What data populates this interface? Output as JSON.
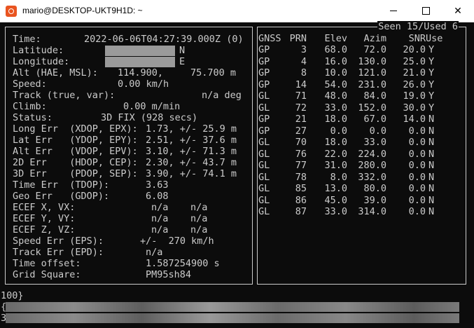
{
  "window": {
    "title": "mario@DESKTOP-UKT9H1D: ~"
  },
  "left": {
    "time": {
      "label": "Time:",
      "value": "2022-06-06T04:27:39.000Z (0)"
    },
    "latitude": {
      "label": "Latitude:",
      "hemisphere": "N"
    },
    "longitude": {
      "label": "Longitude:",
      "hemisphere": "E"
    },
    "alt": {
      "label": "Alt (HAE, MSL):",
      "value1": "114.900,",
      "value2": "75.700 m"
    },
    "speed": {
      "label": "Speed:",
      "value": "0.00 km/h"
    },
    "track": {
      "label": "Track (true, var):",
      "value": "n/a deg"
    },
    "climb": {
      "label": "Climb:",
      "value": "0.00 m/min"
    },
    "status": {
      "label": "Status:",
      "value": "3D FIX (928 secs)"
    },
    "long_err": {
      "label": "Long Err  (XDOP, EPX):",
      "value": "1.73, +/- 25.9 m"
    },
    "lat_err": {
      "label": "Lat Err   (YDOP, EPY):",
      "value": "2.51, +/- 37.6 m"
    },
    "alt_err": {
      "label": "Alt Err   (VDOP, EPV):",
      "value": "3.10, +/- 71.3 m"
    },
    "err_2d": {
      "label": "2D Err    (HDOP, CEP):",
      "value": "2.30, +/- 43.7 m"
    },
    "err_3d": {
      "label": "3D Err    (PDOP, SEP):",
      "value": "3.90, +/- 74.1 m"
    },
    "time_err": {
      "label": "Time Err  (TDOP):",
      "value": "3.63"
    },
    "geo_err": {
      "label": "Geo Err   (GDOP):",
      "value": "6.08"
    },
    "ecef_x": {
      "label": "ECEF X, VX:",
      "v1": "n/a",
      "v2": "n/a"
    },
    "ecef_y": {
      "label": "ECEF Y, VY:",
      "v1": "n/a",
      "v2": "n/a"
    },
    "ecef_z": {
      "label": "ECEF Z, VZ:",
      "v1": "n/a",
      "v2": "n/a"
    },
    "speed_err": {
      "label": "Speed Err (EPS):",
      "value": "+/-  270 km/h"
    },
    "track_err": {
      "label": "Track Err (EPD):",
      "value": "n/a"
    },
    "time_offset": {
      "label": "Time offset:",
      "value": "1.587254900 s"
    },
    "grid_square": {
      "label": "Grid Square:",
      "value": "PM95sh84"
    }
  },
  "right": {
    "header": "Seen 15/Used  6",
    "columns": [
      "GNSS",
      "PRN",
      "Elev",
      "Azim",
      "SNR",
      "Use"
    ],
    "rows": [
      [
        "GP",
        "3",
        "68.0",
        "72.0",
        "20.0",
        "Y"
      ],
      [
        "GP",
        "4",
        "16.0",
        "130.0",
        "25.0",
        "Y"
      ],
      [
        "GP",
        "8",
        "10.0",
        "121.0",
        "21.0",
        "Y"
      ],
      [
        "GP",
        "14",
        "54.0",
        "231.0",
        "26.0",
        "Y"
      ],
      [
        "GL",
        "71",
        "48.0",
        "84.0",
        "19.0",
        "Y"
      ],
      [
        "GL",
        "72",
        "33.0",
        "152.0",
        "30.0",
        "Y"
      ],
      [
        "GP",
        "21",
        "18.0",
        "67.0",
        "14.0",
        "N"
      ],
      [
        "GP",
        "27",
        "0.0",
        "0.0",
        "0.0",
        "N"
      ],
      [
        "GL",
        "70",
        "18.0",
        "33.0",
        "0.0",
        "N"
      ],
      [
        "GL",
        "76",
        "22.0",
        "224.0",
        "0.0",
        "N"
      ],
      [
        "GL",
        "77",
        "31.0",
        "280.0",
        "0.0",
        "N"
      ],
      [
        "GL",
        "78",
        "8.0",
        "332.0",
        "0.0",
        "N"
      ],
      [
        "GL",
        "85",
        "13.0",
        "80.0",
        "0.0",
        "N"
      ],
      [
        "GL",
        "86",
        "45.0",
        "39.0",
        "0.0",
        "N"
      ],
      [
        "GL",
        "87",
        "33.0",
        "314.0",
        "0.0",
        "N"
      ]
    ]
  },
  "log": {
    "line1": "100}",
    "line2_prefix": "{",
    "line3_prefix": "3"
  }
}
